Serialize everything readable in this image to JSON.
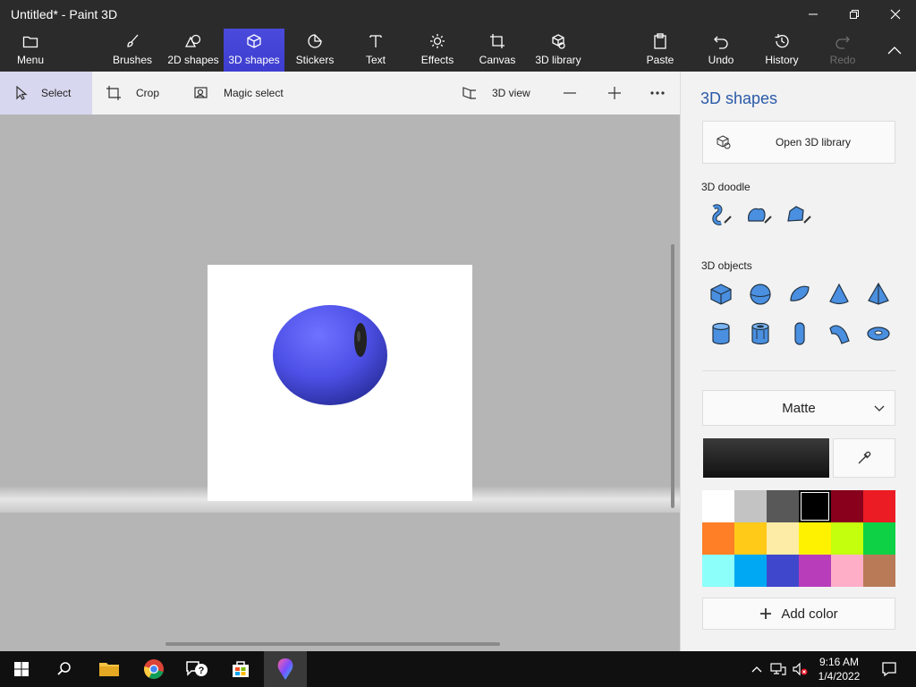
{
  "window": {
    "title": "Untitled* - Paint 3D"
  },
  "ribbon": {
    "menu": "Menu",
    "tools": [
      {
        "label": "Brushes"
      },
      {
        "label": "2D shapes"
      },
      {
        "label": "3D shapes"
      },
      {
        "label": "Stickers"
      },
      {
        "label": "Text"
      },
      {
        "label": "Effects"
      },
      {
        "label": "Canvas"
      },
      {
        "label": "3D library"
      }
    ],
    "actions": [
      {
        "label": "Paste"
      },
      {
        "label": "Undo"
      },
      {
        "label": "History"
      },
      {
        "label": "Redo"
      }
    ],
    "active_tool": "3D shapes"
  },
  "toolbar": {
    "select": "Select",
    "crop": "Crop",
    "magic_select": "Magic select",
    "view_3d": "3D view"
  },
  "panel": {
    "title": "3D shapes",
    "open_library": "Open 3D library",
    "doodle_label": "3D doodle",
    "objects_label": "3D objects",
    "material": "Matte",
    "add_color": "Add color",
    "palette": [
      "#ffffff",
      "#c3c3c3",
      "#585858",
      "#000000",
      "#88001b",
      "#ec1c24",
      "#ff7f27",
      "#ffca18",
      "#fdeca6",
      "#fff200",
      "#c4ff0e",
      "#0ed145",
      "#8cfffb",
      "#00a8f3",
      "#3f48cc",
      "#b83dba",
      "#ffaec8",
      "#b97a57"
    ],
    "selected_color": "#000000"
  },
  "taskbar": {
    "time": "9:16 AM",
    "date": "1/4/2022"
  }
}
